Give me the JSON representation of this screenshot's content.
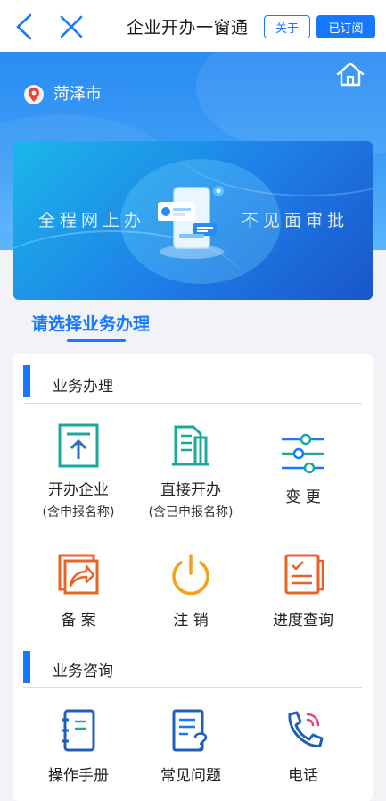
{
  "nav": {
    "title": "企业开办一窗通",
    "about_label": "关于",
    "subscribed_label": "已订阅"
  },
  "header": {
    "city": "菏泽市"
  },
  "banner": {
    "left_text": "全程网上办",
    "right_text": "不见面审批"
  },
  "select_title": "请选择业务办理",
  "sections": {
    "business": {
      "title": "业务办理",
      "items": [
        {
          "label": "开办企业",
          "sub": "(含申报名称)",
          "icon": "upload-doc-icon"
        },
        {
          "label": "直接开办",
          "sub": "(含已申报名称)",
          "icon": "building-icon"
        },
        {
          "label": "变 更",
          "icon": "sliders-icon"
        },
        {
          "label": "备 案",
          "icon": "share-arrow-icon"
        },
        {
          "label": "注 销",
          "icon": "power-icon"
        },
        {
          "label": "进度查询",
          "icon": "checklist-icon"
        }
      ]
    },
    "consult": {
      "title": "业务咨询",
      "items": [
        {
          "label": "操作手册",
          "icon": "notebook-icon"
        },
        {
          "label": "常见问题",
          "icon": "question-doc-icon"
        },
        {
          "label": "电话",
          "icon": "phone-icon"
        }
      ]
    }
  },
  "colors": {
    "primary": "#1677ff",
    "teal": "#1aa89c",
    "orange": "#e8632a",
    "gold": "#f0a21c",
    "navy": "#1f5fb8"
  }
}
